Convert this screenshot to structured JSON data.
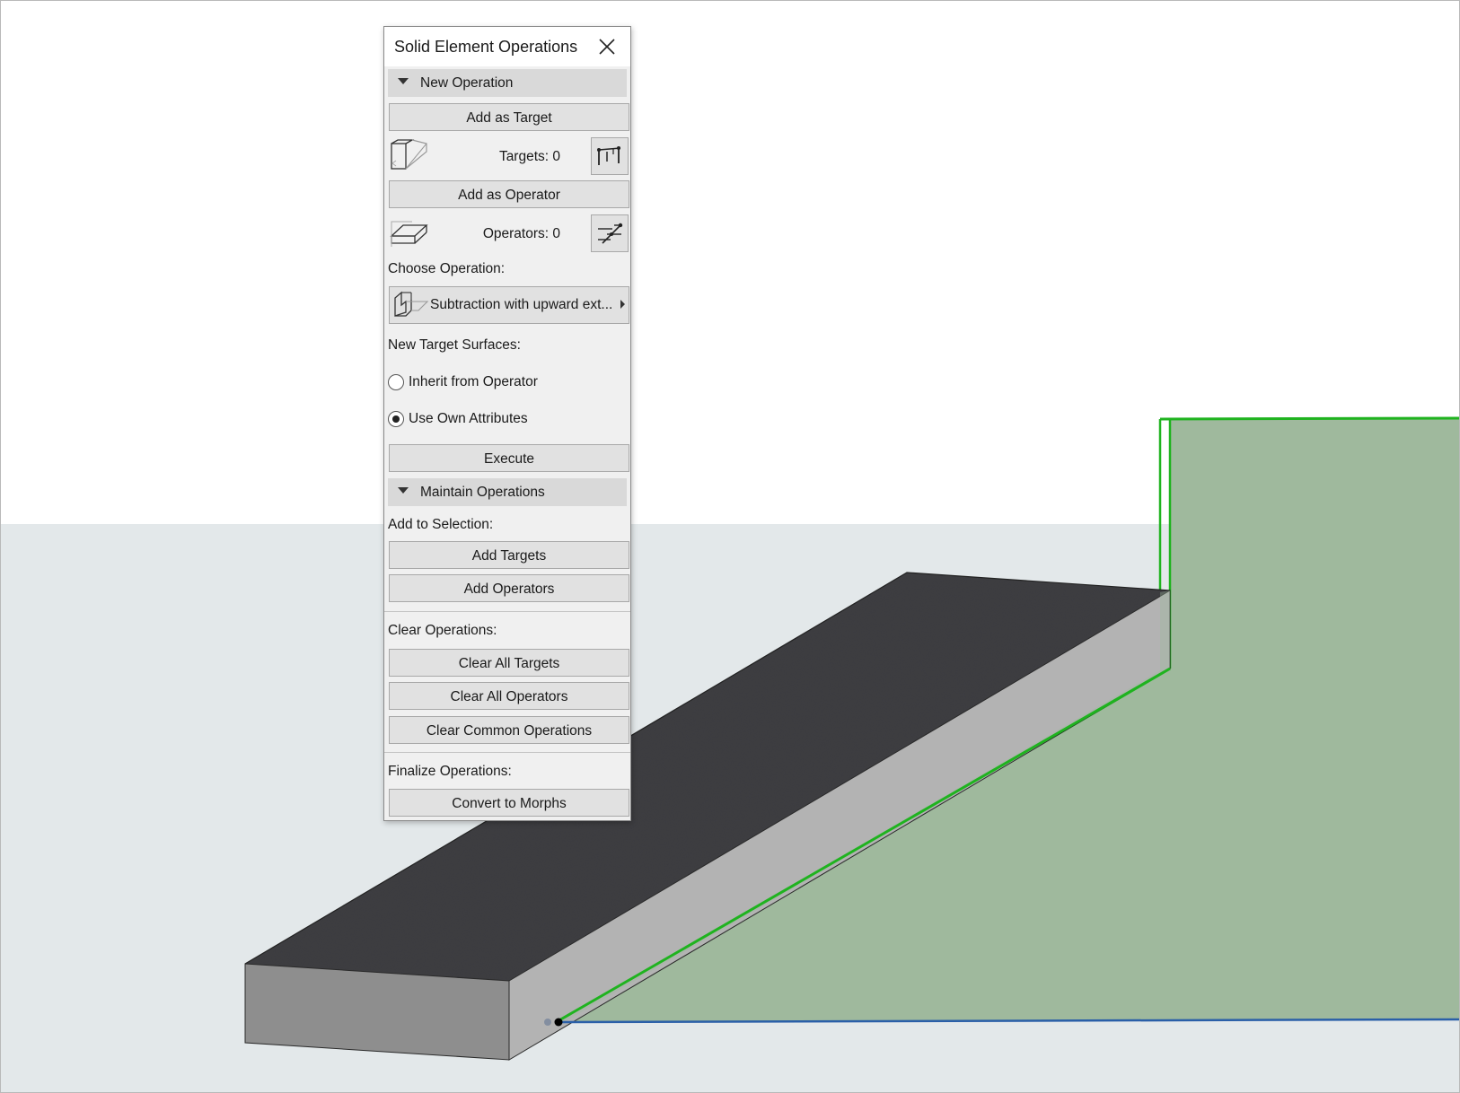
{
  "palette": {
    "title": "Solid Element Operations",
    "new_operation": {
      "section_label": "New Operation",
      "add_as_target": "Add as Target",
      "targets_count": "Targets: 0",
      "add_as_operator": "Add as Operator",
      "operators_count": "Operators: 0",
      "choose_operation_label": "Choose Operation:",
      "choose_operation_value": "Subtraction with upward ext...",
      "new_target_surfaces_label": "New Target Surfaces:",
      "radio_inherit": "Inherit from Operator",
      "radio_own": "Use Own Attributes",
      "selected_radio": "Use Own Attributes",
      "execute": "Execute"
    },
    "maintain_operations": {
      "section_label": "Maintain Operations",
      "add_to_selection_label": "Add to Selection:",
      "add_targets": "Add Targets",
      "add_operators": "Add Operators",
      "clear_operations_label": "Clear Operations:",
      "clear_all_targets": "Clear All Targets",
      "clear_all_operators": "Clear All Operators",
      "clear_common_operations": "Clear Common Operations",
      "finalize_operations_label": "Finalize Operations:",
      "convert_to_morphs": "Convert to Morphs"
    }
  },
  "icons": {
    "close": "close-icon",
    "target_element": "target-element-icon",
    "select_targets": "select-targets-icon",
    "operator_element": "operator-element-icon",
    "select_operators": "select-operators-icon",
    "operation_type": "subtraction-upward-icon"
  },
  "colors": {
    "sky": "#ffffff",
    "ground": "#e3e8ea",
    "slab_top": "#3e3e42",
    "slab_front": "#8e8e8e",
    "slab_side": "#b3b3b3",
    "operator_fill": "#9fb99d",
    "operator_edge": "#1fb31f",
    "baseline": "#2a5fa8"
  }
}
